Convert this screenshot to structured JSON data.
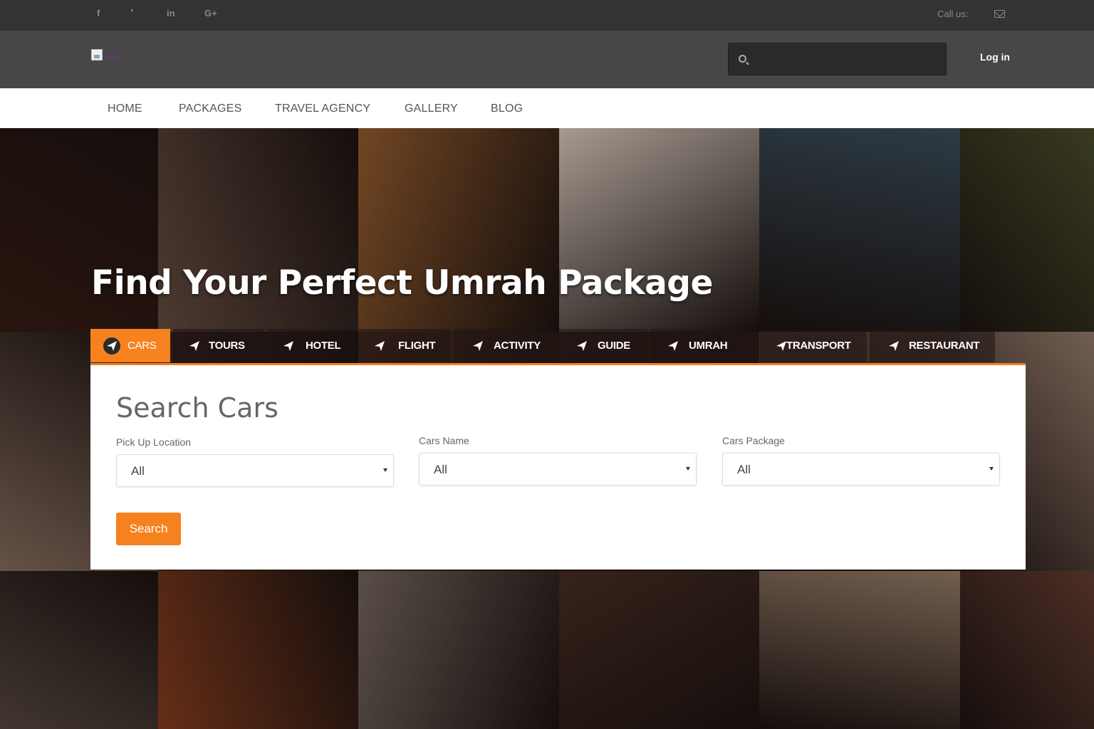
{
  "topbar": {
    "social": [
      {
        "icon": "facebook-icon",
        "glyph": "f"
      },
      {
        "icon": "twitter-icon",
        "glyph": "❛"
      },
      {
        "icon": "linkedin-icon",
        "glyph": "in"
      },
      {
        "icon": "google-plus-icon",
        "glyph": "G+"
      }
    ],
    "call_label": "Call us:",
    "mail_icon": "mail-icon"
  },
  "header": {
    "logo_alt": "logo",
    "search_placeholder": "",
    "login_label": "Log in"
  },
  "nav": {
    "items": [
      "HOME",
      "PACKAGES",
      "TRAVEL AGENCY",
      "GALLERY",
      "BLOG"
    ]
  },
  "hero": {
    "title": "Find Your Perfect Umrah Package"
  },
  "tabs": {
    "items": [
      "CARS",
      "TOURS",
      "HOTEL",
      "FLIGHT",
      "ACTIVITY",
      "GUIDE",
      "UMRAH",
      "TRANSPORT",
      "RESTAURANT"
    ],
    "active": "CARS",
    "icon": "paper-plane-icon"
  },
  "search_panel": {
    "title": "Search Cars",
    "fields": [
      {
        "label": "Pick Up Location",
        "value": "All"
      },
      {
        "label": "Cars Name",
        "value": "All"
      },
      {
        "label": "Cars Package",
        "value": "All"
      }
    ],
    "button_label": "Search"
  },
  "colors": {
    "accent": "#f5821f",
    "topbar": "#333333",
    "header": "#474747",
    "nav": "#ffffff"
  }
}
